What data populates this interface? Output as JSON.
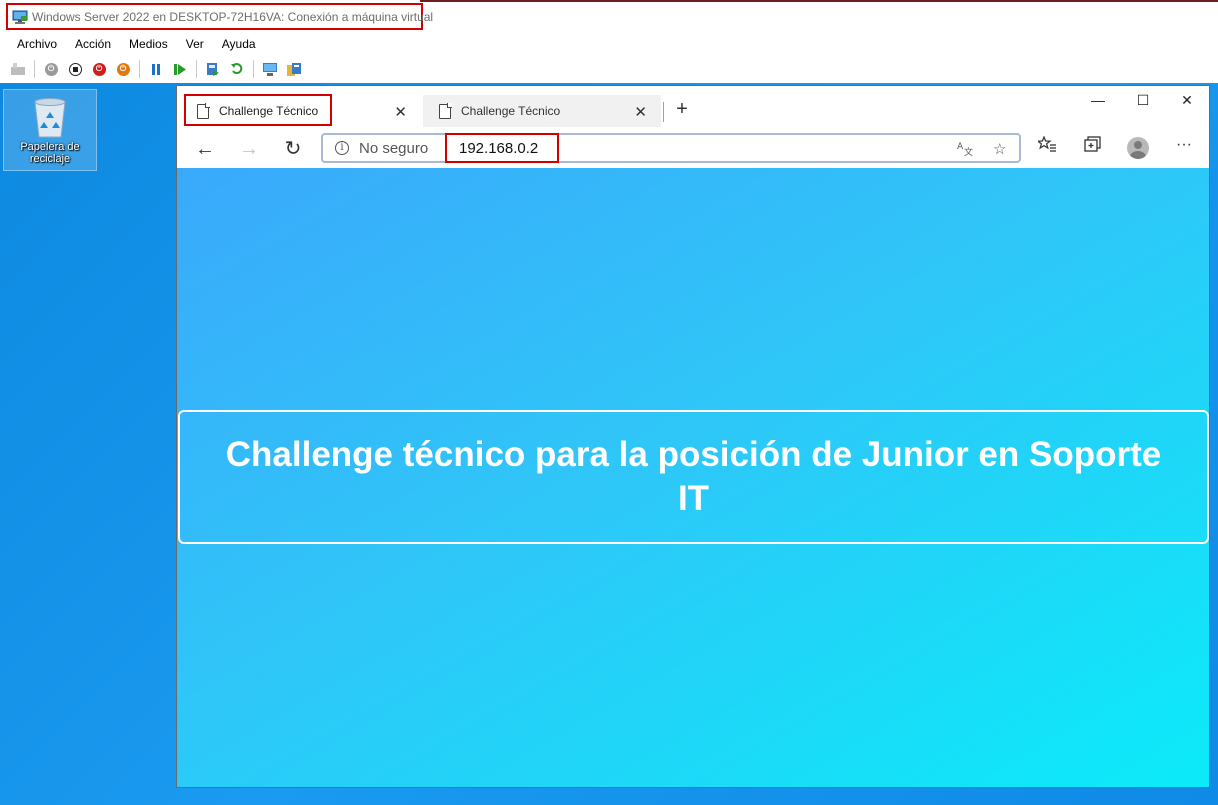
{
  "vm": {
    "title": "Windows Server 2022 en DESKTOP-72H16VA: Conexión a máquina virtual",
    "menu": [
      "Archivo",
      "Acción",
      "Medios",
      "Ver",
      "Ayuda"
    ]
  },
  "desktop": {
    "recycle_bin_label": "Papelera de reciclaje"
  },
  "browser": {
    "tabs": [
      {
        "title": "Challenge Técnico"
      },
      {
        "title": "Challenge Técnico"
      }
    ],
    "address": {
      "security_label": "No seguro",
      "url": "192.168.0.2"
    }
  },
  "page": {
    "heading": "Challenge técnico para la posición de Junior en Soporte IT"
  },
  "colors": {
    "highlight": "#d40000",
    "desktop_bg": "#1a9af0",
    "page_gradient_start": "#3aa9fb",
    "page_gradient_end": "#0bebf9"
  }
}
